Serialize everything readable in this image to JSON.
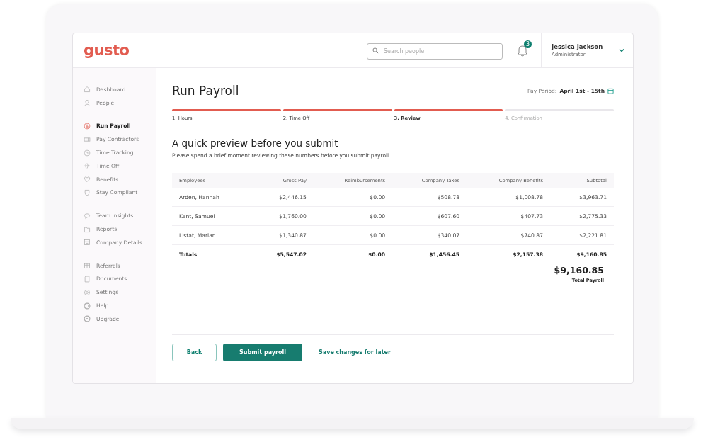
{
  "header": {
    "logo": "gusto",
    "search": {
      "placeholder": "Search people"
    },
    "notifications": {
      "count": "3"
    },
    "user": {
      "name": "Jessica Jackson",
      "role": "Administrator"
    }
  },
  "sidebar": {
    "groups": [
      [
        {
          "label": "Dashboard",
          "selected": false
        },
        {
          "label": "People",
          "selected": false
        }
      ],
      [
        {
          "label": "Run Payroll",
          "selected": true
        },
        {
          "label": "Pay Contractors",
          "selected": false
        },
        {
          "label": "Time Tracking",
          "selected": false
        },
        {
          "label": "Time Off",
          "selected": false
        },
        {
          "label": "Benefits",
          "selected": false
        },
        {
          "label": "Stay Compliant",
          "selected": false
        }
      ],
      [
        {
          "label": "Team Insights",
          "selected": false
        },
        {
          "label": "Reports",
          "selected": false
        },
        {
          "label": "Company Details",
          "selected": false
        }
      ],
      [
        {
          "label": "Referrals",
          "selected": false
        },
        {
          "label": "Documents",
          "selected": false
        },
        {
          "label": "Settings",
          "selected": false
        },
        {
          "label": "Help",
          "selected": false
        },
        {
          "label": "Upgrade",
          "selected": false
        }
      ]
    ]
  },
  "page": {
    "title": "Run Payroll",
    "pay_period": {
      "label": "Pay Period:",
      "value": "April 1st - 15th"
    },
    "steps": [
      {
        "label": "1. Hours",
        "active": true,
        "selected": false
      },
      {
        "label": "2. Time Off",
        "active": true,
        "selected": false
      },
      {
        "label": "3. Review",
        "active": true,
        "selected": true
      },
      {
        "label": "4. Confirmation",
        "active": false,
        "selected": false
      }
    ],
    "heading": "A quick preview before you submit",
    "subheading": "Please spend a brief moment reviewing these numbers before you submit payroll.",
    "table": {
      "columns": [
        "Employees",
        "Gross Pay",
        "Reimbursements",
        "Company Taxes",
        "Company Benefits",
        "Subtotal"
      ],
      "rows": [
        [
          "Arden, Hannah",
          "$2,446.15",
          "$0.00",
          "$508.78",
          "$1,008.78",
          "$3,963.71"
        ],
        [
          "Kant, Samuel",
          "$1,760.00",
          "$0.00",
          "$607.60",
          "$407.73",
          "$2,775.33"
        ],
        [
          "Listat, Marian",
          "$1,340.87",
          "$0.00",
          "$340.07",
          "$740.87",
          "$2,221.81"
        ]
      ],
      "totals": [
        "Totals",
        "$5,547.02",
        "$0.00",
        "$1,456.45",
        "$2,157.38",
        "$9,160.85"
      ]
    },
    "total_payroll": {
      "amount": "$9,160.85",
      "label": "Total Payroll"
    },
    "buttons": {
      "back": "Back",
      "submit": "Submit payroll",
      "save": "Save changes for later"
    }
  }
}
